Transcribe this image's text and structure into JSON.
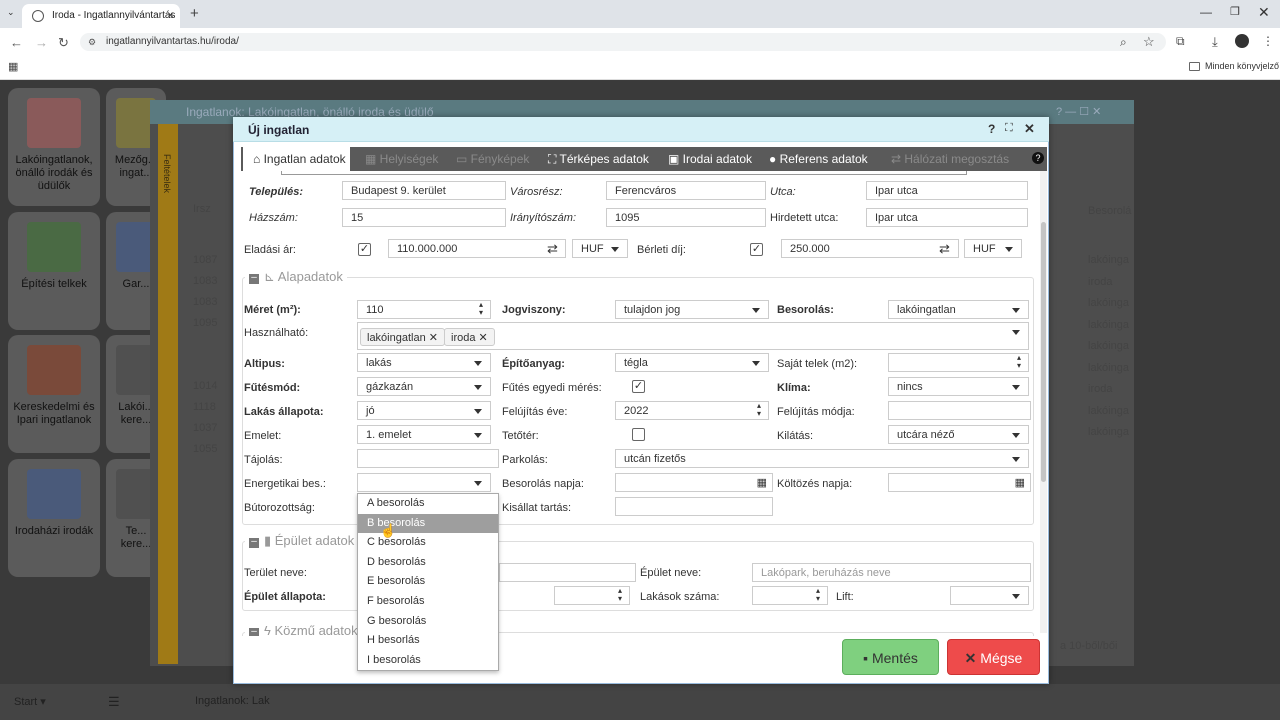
{
  "browser": {
    "tab_title": "Iroda - Ingatlannyilvántartás",
    "url": "ingatlannyilvantartas.hu/iroda/",
    "bookmarks_label": "Minden könyvjelző"
  },
  "desktop": {
    "tiles": [
      {
        "label": "Lakóingatlanok, önálló irodák és üdülők"
      },
      {
        "label": "Mezőg... ingat..."
      },
      {
        "label": "Építési telkek"
      },
      {
        "label": "Gar..."
      },
      {
        "label": "Kereskedelmi és Ipari ingatlanok"
      },
      {
        "label": "Lakói... kere..."
      },
      {
        "label": "Irodaházi irodák"
      },
      {
        "label": "Te... kere..."
      }
    ],
    "taskbar": {
      "start": "Start",
      "item": "Ingatlanok: Lak"
    }
  },
  "bg_window": {
    "title": "Ingatlanok: Lakóingatlan, önálló iroda és üdülő",
    "side_label": "Feltételek",
    "col_irsz": "Irsz",
    "col_besorolas": "Besorolá",
    "rows_irsz": [
      "1087",
      "1083",
      "1083",
      "1095",
      "",
      "1014",
      "1118",
      "1037",
      "1055"
    ],
    "rows_besorolas": [
      "lakóinga",
      "iroda",
      "lakóinga",
      "lakóinga",
      "lakóinga",
      "lakóinga",
      "iroda",
      "lakóinga",
      "lakóinga"
    ],
    "pager": "a 10-ből/bői"
  },
  "dialog": {
    "title": "Új ingatlan",
    "tabs": [
      {
        "label": "Ingatlan adatok"
      },
      {
        "label": "Helyiségek"
      },
      {
        "label": "Fényképek"
      },
      {
        "label": "Térképes adatok"
      },
      {
        "label": "Irodai adatok"
      },
      {
        "label": "Referens adatok"
      },
      {
        "label": "Hálózati megosztás"
      }
    ],
    "fields": {
      "telepules_label": "Település:",
      "telepules": "Budapest 9. kerület",
      "varosresz_label": "Városrész:",
      "varosresz": "Ferencváros",
      "utca_label": "Utca:",
      "utca": "Ipar utca",
      "hazszam_label": "Házszám:",
      "hazszam": "15",
      "iranyitoszam_label": "Irányítószám:",
      "iranyitoszam": "1095",
      "hirdetett_utca_label": "Hirdetett utca:",
      "hirdetett_utca": "Ipar utca",
      "eladasi_ar_label": "Eladási ár:",
      "eladasi_ar": "110.000.000",
      "eladasi_curr": "HUF",
      "berleti_dij_label": "Bérleti díj:",
      "berleti_dij": "250.000",
      "berleti_curr": "HUF"
    },
    "alapadatok": {
      "title": "Alapadatok",
      "meret_label": "Méret (m²):",
      "meret": "110",
      "jogviszony_label": "Jogviszony:",
      "jogviszony": "tulajdon jog",
      "besorolas_label": "Besorolás:",
      "besorolas": "lakóingatlan",
      "hasznalhato_label": "Használható:",
      "hasznalhato_chips": [
        "lakóingatlan",
        "iroda"
      ],
      "altipus_label": "Altipus:",
      "altipus": "lakás",
      "epitoanyag_label": "Építőanyag:",
      "epitoanyag": "tégla",
      "sajat_telek_label": "Saját telek (m2):",
      "sajat_telek": "",
      "futesmod_label": "Fűtésmód:",
      "futesmod": "gázkazán",
      "futes_egyedi_label": "Fűtés egyedi mérés:",
      "klima_label": "Klíma:",
      "klima": "nincs",
      "lakas_allapota_label": "Lakás állapota:",
      "lakas_allapota": "jó",
      "felujitas_eve_label": "Felújítás éve:",
      "felujitas_eve": "2022",
      "felujitas_modja_label": "Felújítás módja:",
      "felujitas_modja": "",
      "emelet_label": "Emelet:",
      "emelet": "1. emelet",
      "tetoter_label": "Tetőtér:",
      "kilatas_label": "Kilátás:",
      "kilatas": "utcára néző",
      "tajolas_label": "Tájolás:",
      "tajolas": "",
      "parkolas_label": "Parkolás:",
      "parkolas": "utcán fizetős",
      "energetikai_label": "Energetikai bes.:",
      "energetikai": "",
      "besorolas_napja_label": "Besorolás napja:",
      "koltozes_napja_label": "Költözés napja:",
      "butorozottsag_label": "Bútorozottság:",
      "kisallat_label": "Kisállat tartás:"
    },
    "epulet": {
      "title": "Épület adatok",
      "terulet_neve_label": "Terület neve:",
      "epulet_neve_label": "Épület neve:",
      "epulet_neve_placeholder": "Lakópark, beruházás neve",
      "epulet_allapota_label": "Épület állapota:",
      "lakasok_szama_label": "Lakások száma:",
      "lift_label": "Lift:"
    },
    "kozmu": {
      "title": "Közmű adatok"
    },
    "energy_options": [
      "A besorolás",
      "B besorolás",
      "C besorolás",
      "D besorolás",
      "E besorolás",
      "F besorolás",
      "G besorolás",
      "H besorlás",
      "I besorolás"
    ],
    "energy_highlighted": "B besorolás",
    "save_label": "Mentés",
    "cancel_label": "Mégse"
  }
}
